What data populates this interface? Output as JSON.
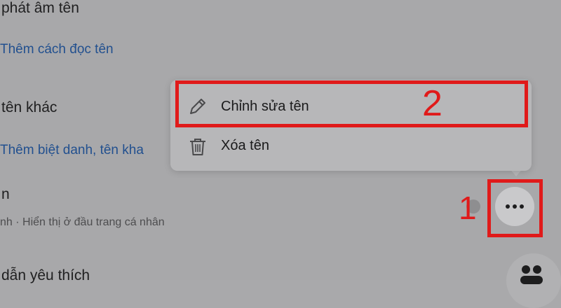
{
  "sections": {
    "pronunciation_heading": "phát âm tên",
    "add_pronunciation_link": "Thêm cách đọc tên",
    "other_names_heading": "tên khác",
    "add_nickname_link": "Thêm biệt danh, tên kha",
    "name_entry_heading": "n",
    "name_entry_sub": "nh · Hiển thị ở đầu trang cá nhân",
    "favorite_quotes_heading": "dẫn yêu thích"
  },
  "menu": {
    "items": [
      {
        "label": "Chỉnh sửa tên",
        "icon": "pencil-icon"
      },
      {
        "label": "Xóa tên",
        "icon": "trash-icon"
      }
    ]
  },
  "annotations": {
    "step_1": "1",
    "step_2": "2",
    "color": "#e01a1a"
  },
  "icons": {
    "more_button": "more-dots-icon",
    "people": "people-icon"
  }
}
